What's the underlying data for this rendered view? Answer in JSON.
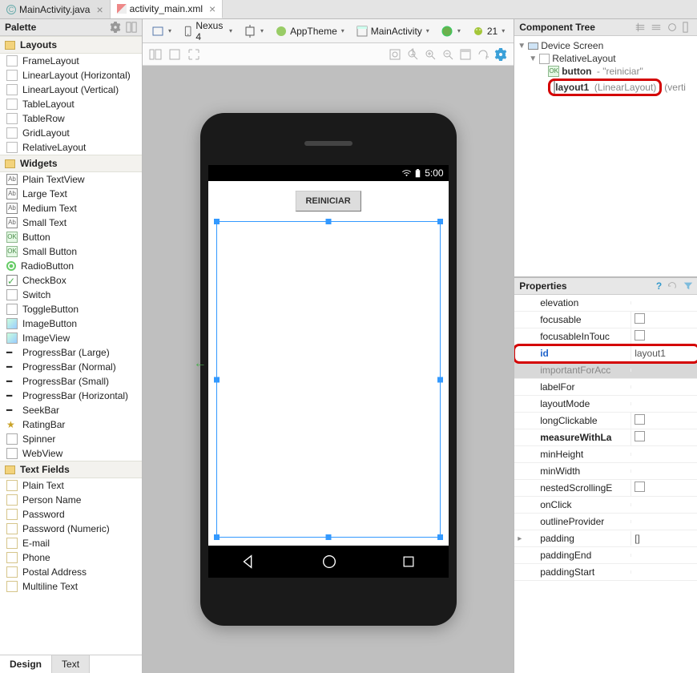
{
  "tabs": {
    "main_activity_java": "MainActivity.java",
    "activity_main_xml": "activity_main.xml"
  },
  "palette": {
    "title": "Palette",
    "groups": [
      {
        "name": "Layouts",
        "items": [
          "FrameLayout",
          "LinearLayout (Horizontal)",
          "LinearLayout (Vertical)",
          "TableLayout",
          "TableRow",
          "GridLayout",
          "RelativeLayout"
        ]
      },
      {
        "name": "Widgets",
        "items": [
          "Plain TextView",
          "Large Text",
          "Medium Text",
          "Small Text",
          "Button",
          "Small Button",
          "RadioButton",
          "CheckBox",
          "Switch",
          "ToggleButton",
          "ImageButton",
          "ImageView",
          "ProgressBar (Large)",
          "ProgressBar (Normal)",
          "ProgressBar (Small)",
          "ProgressBar (Horizontal)",
          "SeekBar",
          "RatingBar",
          "Spinner",
          "WebView"
        ]
      },
      {
        "name": "Text Fields",
        "items": [
          "Plain Text",
          "Person Name",
          "Password",
          "Password (Numeric)",
          "E-mail",
          "Phone",
          "Postal Address",
          "Multiline Text"
        ]
      }
    ],
    "footer": {
      "design": "Design",
      "text": "Text"
    }
  },
  "toolbar": {
    "device": "Nexus 4",
    "theme": "AppTheme",
    "activity": "MainActivity",
    "api": "21"
  },
  "canvas": {
    "status_time": "5:00",
    "button_label": "REINICIAR"
  },
  "component_tree": {
    "title": "Component Tree",
    "root": "Device Screen",
    "relative": "RelativeLayout",
    "button_name": "button",
    "button_text": "\"reiniciar\"",
    "layout_name": "layout1",
    "layout_type": "(LinearLayout)",
    "layout_orient": "(verti"
  },
  "properties": {
    "title": "Properties",
    "rows": [
      {
        "name": "elevation",
        "val": ""
      },
      {
        "name": "focusable",
        "val": "checkbox"
      },
      {
        "name": "focusableInTouc",
        "val": "checkbox"
      },
      {
        "name": "id",
        "val": "layout1",
        "highlight": true
      },
      {
        "name": "importantForAcc",
        "val": "",
        "header": true
      },
      {
        "name": "labelFor",
        "val": ""
      },
      {
        "name": "layoutMode",
        "val": ""
      },
      {
        "name": "longClickable",
        "val": "checkbox"
      },
      {
        "name": "measureWithLa",
        "val": "checkbox",
        "bold": true
      },
      {
        "name": "minHeight",
        "val": ""
      },
      {
        "name": "minWidth",
        "val": ""
      },
      {
        "name": "nestedScrollingE",
        "val": "checkbox"
      },
      {
        "name": "onClick",
        "val": ""
      },
      {
        "name": "outlineProvider",
        "val": ""
      },
      {
        "name": "padding",
        "val": "[]",
        "expandable": true
      },
      {
        "name": "paddingEnd",
        "val": ""
      },
      {
        "name": "paddingStart",
        "val": ""
      }
    ]
  }
}
